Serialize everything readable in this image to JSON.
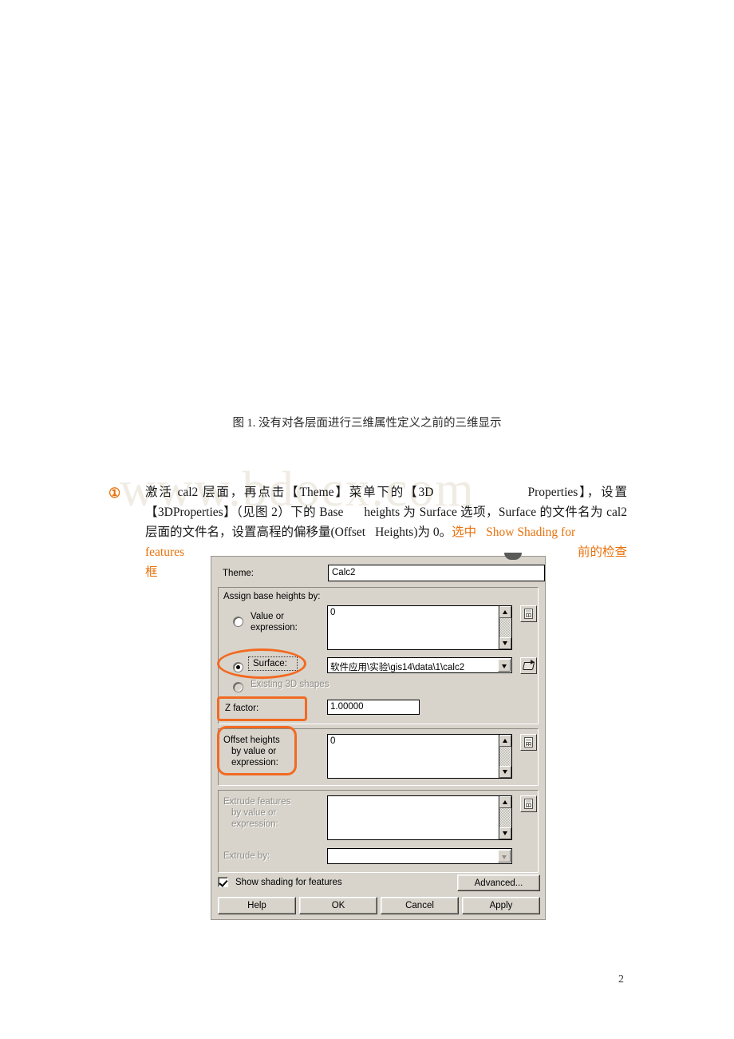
{
  "page": {
    "watermark": "www.bdocx.com",
    "page_number": "2",
    "figure_caption": "图 1. 没有对各层面进行三维属性定义之前的三维显示"
  },
  "paragraph": {
    "bullet": "①",
    "line1_a": "激活 cal2 层面，再点击【Theme】菜单下的【3D",
    "line1_b": "Properties】，设置【3D",
    "line2_a": "Properties】（见图 2）下的 Base",
    "line2_b": "heights 为 Surface 选项，Surface 的文件名为 cal2",
    "line3_a": "层面的文件名，设置高程的偏移量(Offset",
    "line3_b": "Heights)为 0。",
    "line3_orange_a": "选中",
    "line3_orange_b": "Show Shading for",
    "line4_orange_left": "features",
    "line4_orange_right": "前的检查",
    "line5_orange": "框"
  },
  "dialog": {
    "theme_label": "Theme:",
    "theme_value": "Calc2",
    "base_heights": {
      "title": "Assign base heights by:",
      "value_or_expression_label": "Value or\nexpression:",
      "value_or_expression_label_line1": "Value or",
      "value_or_expression_label_line2": "expression:",
      "value_or_expression_value": "0",
      "value_or_expression_selected": false,
      "surface_label": "Surface:",
      "surface_selected": true,
      "surface_value": "软件应用\\实验\\gis14\\data\\1\\calc2",
      "existing_3d_shapes_label": "Existing 3D shapes",
      "existing_3d_shapes_selected": false,
      "existing_3d_shapes_disabled": true,
      "z_factor_label": "Z factor:",
      "z_factor_value": "1.00000"
    },
    "offset": {
      "label_line1": "Offset heights",
      "label_line2": "by value or",
      "label_line3": "expression:",
      "value": "0"
    },
    "extrude": {
      "label_line1": "Extrude features",
      "label_line2": "by value or",
      "label_line3": "expression:",
      "value": "",
      "extrude_by_label": "Extrude by:",
      "extrude_by_value": "",
      "disabled": true
    },
    "show_shading_label": "Show shading for features",
    "show_shading_checked": true,
    "buttons": {
      "advanced": "Advanced...",
      "help": "Help",
      "ok": "OK",
      "cancel": "Cancel",
      "apply": "Apply"
    }
  },
  "colors": {
    "annotation_orange": "#f26a21",
    "text_orange": "#e8720c",
    "dialog_face": "#d8d4cc",
    "watermark_gray": "#f0ece4"
  }
}
